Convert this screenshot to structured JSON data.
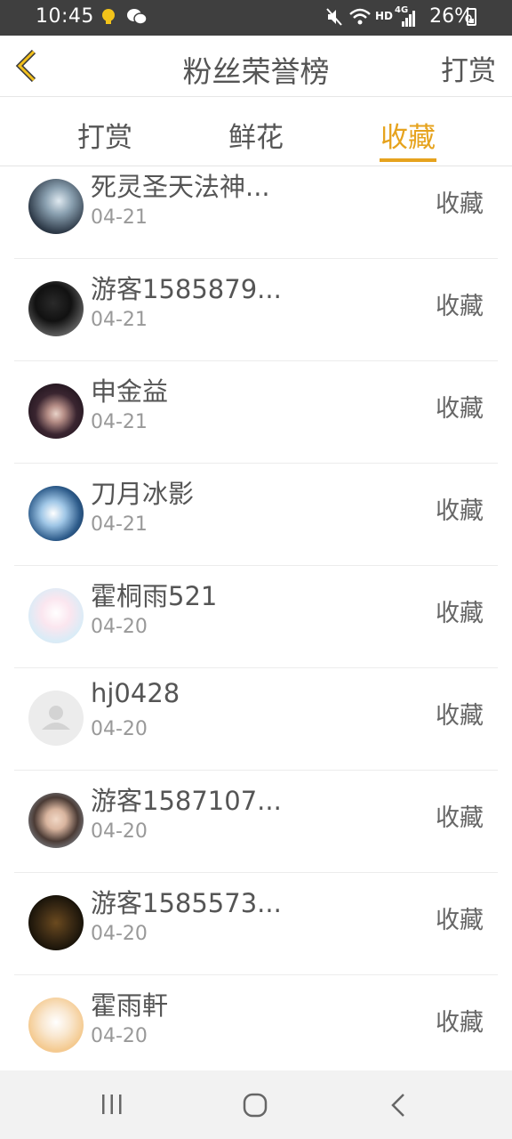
{
  "status_bar": {
    "time": "10:45",
    "net": "HD",
    "signal": "4G",
    "battery": "26%"
  },
  "header": {
    "title": "粉丝荣誉榜",
    "right_action": "打赏"
  },
  "tabs": [
    {
      "label": "打赏",
      "active": false
    },
    {
      "label": "鲜花",
      "active": false
    },
    {
      "label": "收藏",
      "active": true
    }
  ],
  "accent_color": "#e6a31e",
  "entries": [
    {
      "name": "死灵圣天法神...",
      "date": "04-21",
      "action": "收藏"
    },
    {
      "name": "游客1585879...",
      "date": "04-21",
      "action": "收藏"
    },
    {
      "name": "申金益",
      "date": "04-21",
      "action": "收藏"
    },
    {
      "name": "刀月冰影",
      "date": "04-21",
      "action": "收藏"
    },
    {
      "name": "霍桐雨521",
      "date": "04-20",
      "action": "收藏"
    },
    {
      "name": "hj0428",
      "date": "04-20",
      "action": "收藏"
    },
    {
      "name": "游客1587107...",
      "date": "04-20",
      "action": "收藏"
    },
    {
      "name": "游客1585573...",
      "date": "04-20",
      "action": "收藏"
    },
    {
      "name": "霍雨軒",
      "date": "04-20",
      "action": "收藏"
    }
  ]
}
